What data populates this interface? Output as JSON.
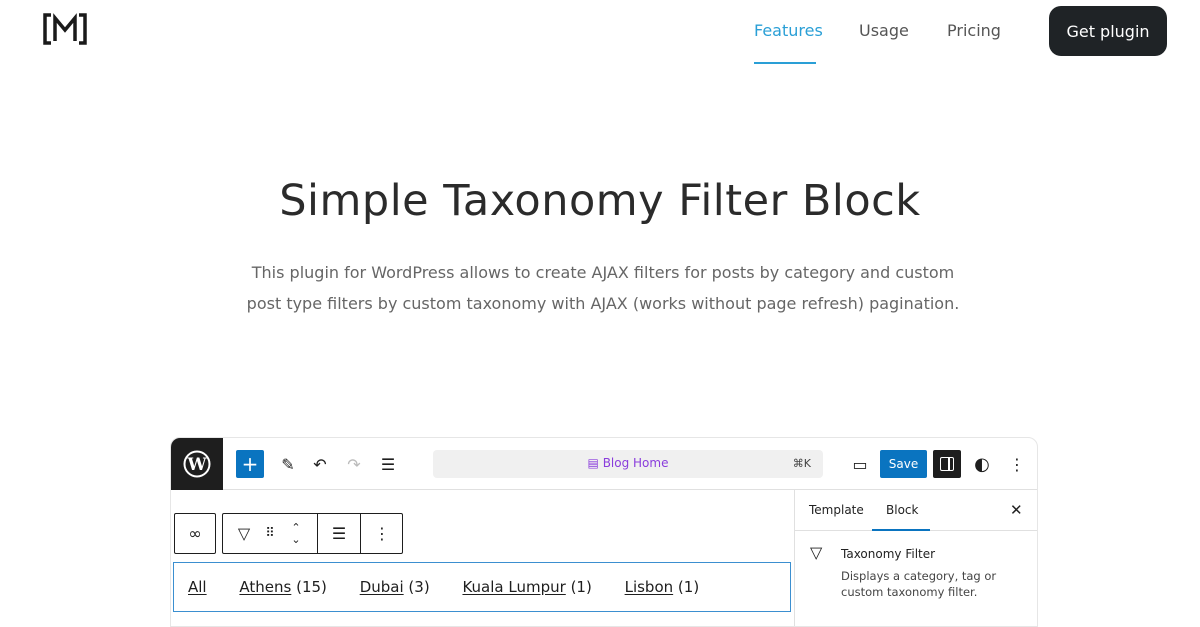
{
  "header": {
    "logo": "[M]",
    "nav": [
      {
        "label": "Features",
        "active": true
      },
      {
        "label": "Usage"
      },
      {
        "label": "Pricing"
      }
    ],
    "cta": "Get plugin",
    "accent": "#2a9fd6"
  },
  "hero": {
    "title": "Simple Taxonomy Filter Block",
    "description": "This plugin for WordPress allows to create AJAX filters for posts by category and custom post type filters by custom taxonomy with AJAX (works without page refresh) pagination."
  },
  "editor": {
    "template_title": "Blog Home",
    "shortcut": "⌘K",
    "save": "Save",
    "filter_items": [
      {
        "label": "All",
        "count": ""
      },
      {
        "label": "Athens",
        "count": "(15)"
      },
      {
        "label": "Dubai",
        "count": "(3)"
      },
      {
        "label": "Kuala Lumpur",
        "count": "(1)"
      },
      {
        "label": "Lisbon",
        "count": "(1)"
      }
    ],
    "sidebar": {
      "tabs": [
        "Template",
        "Block"
      ],
      "active_tab": "Block",
      "block_name": "Taxonomy Filter",
      "block_description": "Displays a category, tag or custom taxonomy filter."
    }
  }
}
